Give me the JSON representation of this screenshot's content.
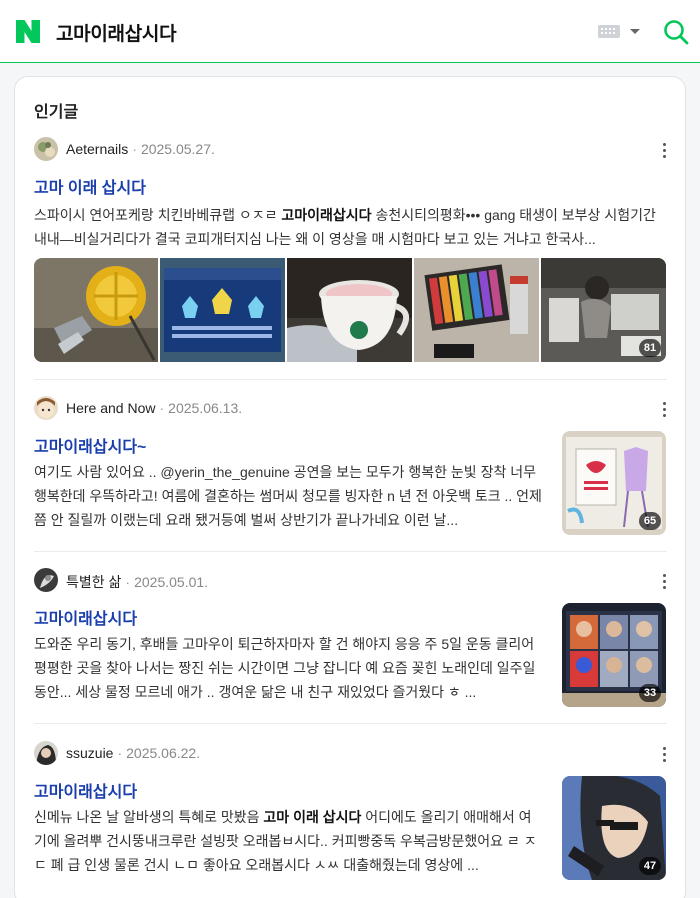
{
  "header": {
    "query": "고마이래삽시다",
    "brand_color": "#03c75a"
  },
  "section": {
    "title": "인기글"
  },
  "posts": [
    {
      "author": "Aeternails",
      "date": "2025.05.27.",
      "title": "고마 이래 삽시다",
      "body_html": "스파이시 연어포케랑 치킨바베큐랩 ㅇㅈㄹ <b>고마이래삽시다</b> 송천시티의평화••• gang 태생이 보부상 시험기간 내내—비실거리다가 결국 코피개터지심 나는 왜 이 영상을 매 시험마다 보고 있는 거냐고 한국사...",
      "image_count": "81"
    },
    {
      "author": "Here and Now",
      "date": "2025.06.13.",
      "title": "고마이래삽시다~",
      "body_html": "여기도 사람 있어요 .. @yerin_the_genuine 공연을 보는 모두가 행복한 눈빛 장착 너무 행복한데 우뜩하라고! 여름에 결혼하는 썸머씨 청모를 빙자한 n 년 전 아웃백 토크 .. 언제쯤 안 질릴까 이랬는데 요래 됐거등예 벌써 상반기가 끝나가네요 이런 날...",
      "image_count": "65"
    },
    {
      "author": "특별한 삶",
      "date": "2025.05.01.",
      "title": "고마이래삽시다",
      "body_html": "도와준 우리 동기, 후배들 고마우이 퇴근하자마자 할 건 해야지 응응 주 5일 운동 클리어 평평한 곳을 찾아 나서는 짱진 쉬는 시간이면 그냥 잡니다 예 요즘 꽂힌 노래인데 일주일 동안... 세상 물정 모르네 애가 .. 갱여운 닮은 내 친구 재있었다 즐거웠다 ㅎ ...",
      "image_count": "33"
    },
    {
      "author": "ssuzuie",
      "date": "2025.06.22.",
      "title": "고마이래삽시다",
      "body_html": "신메뉴 나온 날 알바생의 특혜로 맛봤음 <b>고마 이래 삽시다</b> 어디에도 올리기 애매해서 여기에 올려뿌 건시뚱내크루란 설빙팟 오래봅ㅂ시다.. 커피빵중독 우복금방문했어요 ㄹ ㅈ ㄷ 폐 급 인생 물론 건시 ㄴㅁ 좋아요 오래봅시다 ㅅㅆ 대출해줬는데 영상에 ...",
      "image_count": "47"
    }
  ]
}
